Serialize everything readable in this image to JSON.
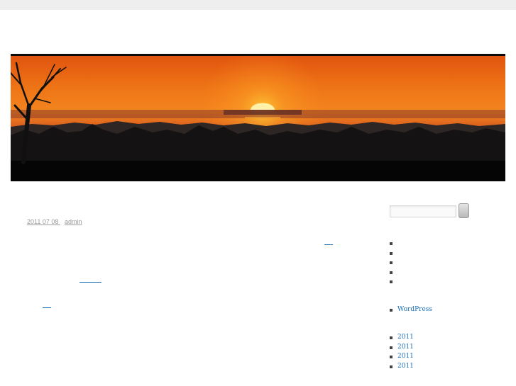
{
  "post": {
    "date": {
      "year": "2011",
      "month": "07",
      "day": "08"
    },
    "author": "admin"
  },
  "sidebar": {
    "meta_links": [
      "WordPress"
    ],
    "archives": [
      "2011",
      "2011",
      "2011",
      "2011"
    ]
  },
  "colors": {
    "link": "#1a6fb5",
    "meta_text": "#999999",
    "top_bar": "#eeeeee",
    "header_rule": "#0a0a0a"
  }
}
